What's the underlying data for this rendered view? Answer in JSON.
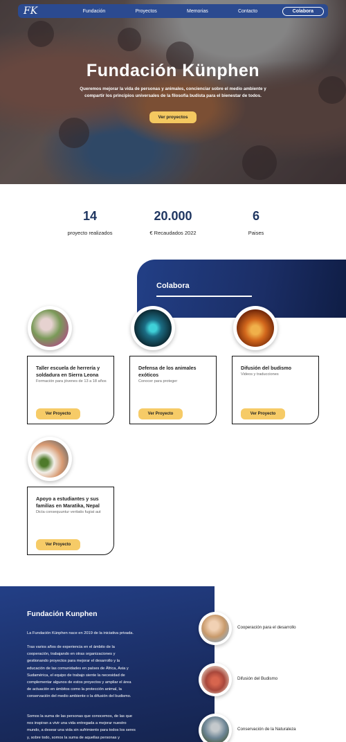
{
  "nav": {
    "logo": "FK",
    "links": [
      "Fundación",
      "Proyectos",
      "Memorias",
      "Contacto"
    ],
    "cta": "Colabora"
  },
  "hero": {
    "title": "Fundación Künphen",
    "subtitle": "Queremos mejorar la vida de personas y animales, concienciar sobre el medio ambiente y compartir los principios universales de la filosofía budista para el bienestar de todos.",
    "button": "Ver proyectos"
  },
  "stats": [
    {
      "value": "14",
      "label": "proyecto realizados"
    },
    {
      "value": "20.000",
      "label": "€ Recaudados 2022"
    },
    {
      "value": "6",
      "label": "Paises"
    }
  ],
  "colabora": {
    "title": "Colabora"
  },
  "projects": [
    {
      "title": "Taller escuela de herrería y soldadura en Sierra Leona",
      "desc": "Formación para jóvenes de 13 a 18 años",
      "button": "Ver Proyecto",
      "thumb_color": "#7a9a58"
    },
    {
      "title": "Defensa de los animales exóticos",
      "desc": "Conocer para proteger",
      "button": "Ver Proyecto",
      "thumb_color": "#0d2b35"
    },
    {
      "title": "Difusión del budismo",
      "desc": "Videos y traducciones",
      "button": "Ver Proyecto",
      "thumb_color": "#b64a12"
    },
    {
      "title": "Apoyo a estudiantes y sus familias en Maratika, Nepal",
      "desc": "Dicta consequuntur veritatis fugiat aut",
      "button": "Ver Proyecto",
      "thumb_color": "#d9c7a6"
    }
  ],
  "about": {
    "title": "Fundación Kunphen",
    "p1": "La Fundación Künphen nace en 2019 de la iniciativa privada.",
    "p2": "Tras varios años de experiencia en el ámbito de la cooperación, trabajando en otras organizaciones y gestionando proyectos para mejorar el desarrollo y la educación de las comunidades en países de África, Asia y Sudamérica, el equipo de trabajo siente la necesidad de complementar algunos de estos proyectos y ampliar el área de actuación en ámbitos como la protección animal, la conservación del medio ambiente o la difusión del budismo.",
    "p3": "Somos la suma de las personas que conocemos, de las que nos inspiran a vivir una vida entregada a mejorar nuestro mundo, a desear una vida sin sufrimiento para todos los seres y, sobre todo, somos la suma de aquellas personas y"
  },
  "areas": [
    {
      "label": "Cooperación para el desarrollo",
      "thumb_color": "#c89a6b"
    },
    {
      "label": "Difusión del Budismo",
      "thumb_color": "#a8473b"
    },
    {
      "label": "Conservación de la Naturaleza",
      "thumb_color": "#6d8595"
    }
  ],
  "colors": {
    "navy": "#223f86",
    "accent_yellow": "#f6cb67",
    "stat_circle": "#fdecd7"
  }
}
